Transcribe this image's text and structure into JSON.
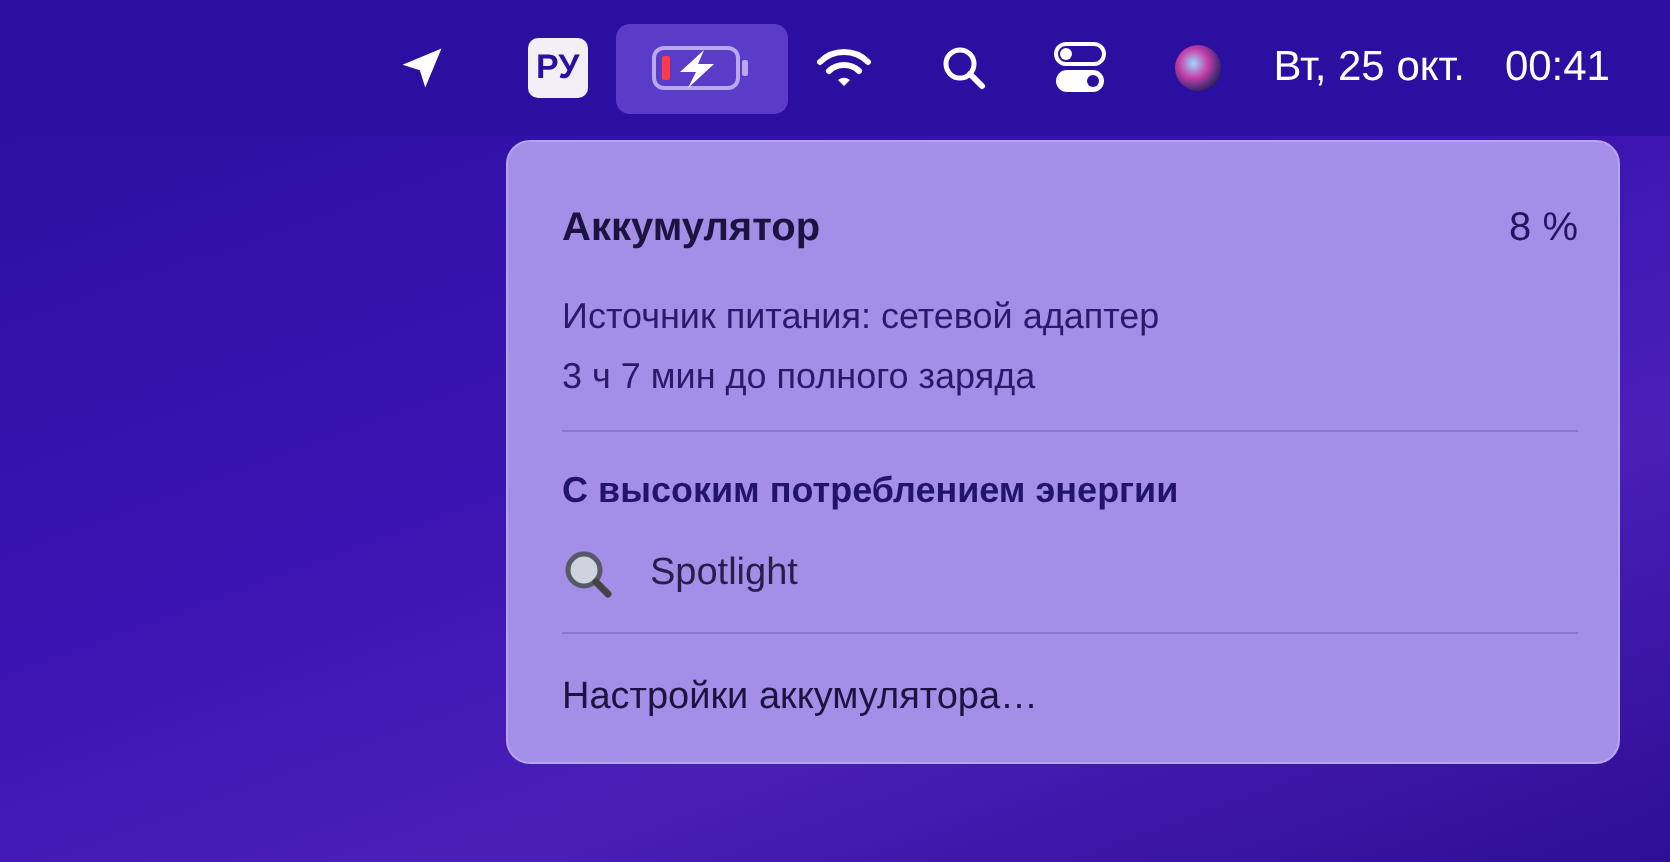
{
  "menu_bar": {
    "input_source": "РУ",
    "battery_selected": true,
    "date": "Вт, 25 окт.",
    "time": "00:41"
  },
  "battery_menu": {
    "title": "Аккумулятор",
    "percent": "8 %",
    "power_source": "Источник питания: сетевой адаптер",
    "time_to_full": "3 ч 7 мин до полного заряда",
    "section_title": "С высоким потреблением энергии",
    "apps": [
      {
        "name": "Spotlight"
      }
    ],
    "settings": "Настройки аккумулятора…"
  }
}
